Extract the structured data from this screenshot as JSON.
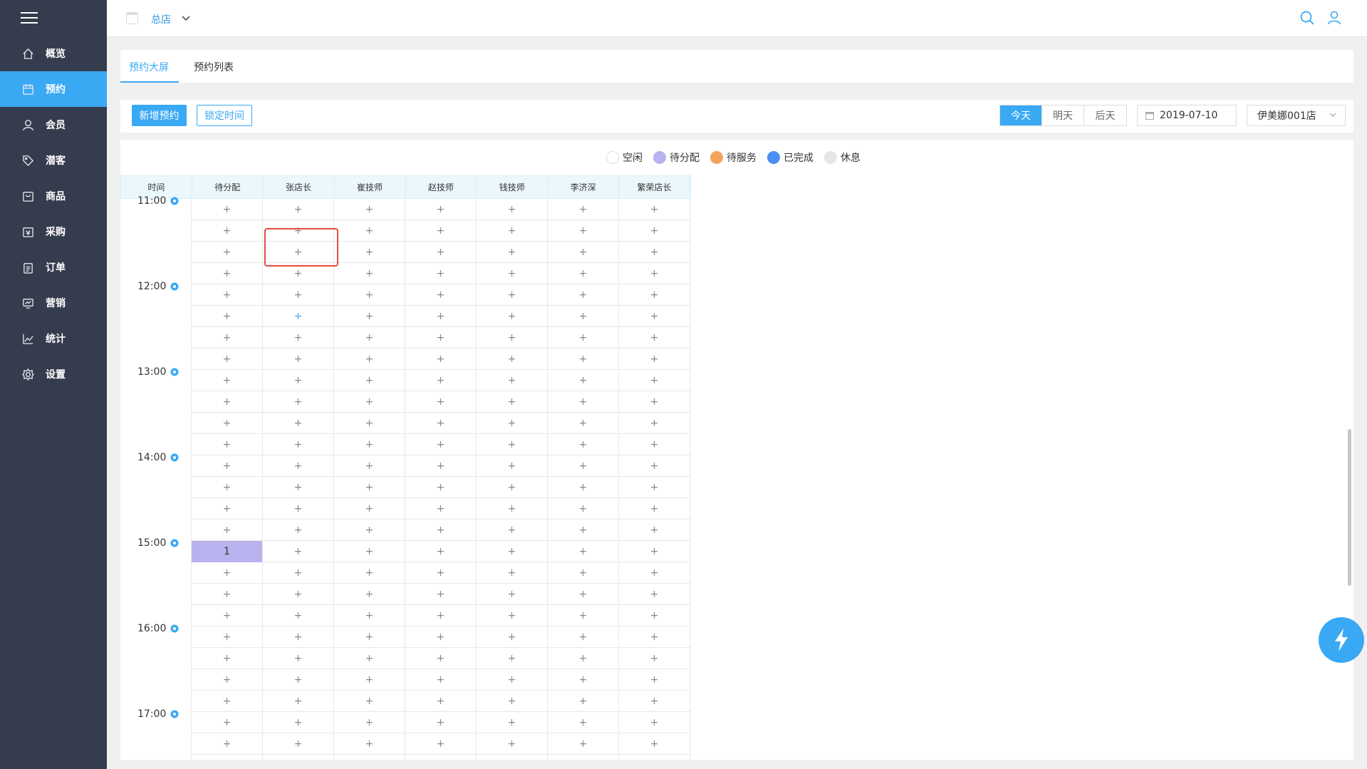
{
  "topbar": {
    "store": "总店"
  },
  "sidebar": {
    "items": [
      {
        "label": "概览",
        "icon": "home-icon"
      },
      {
        "label": "预约",
        "icon": "calendar-icon"
      },
      {
        "label": "会员",
        "icon": "user-icon"
      },
      {
        "label": "潜客",
        "icon": "tag-icon"
      },
      {
        "label": "商品",
        "icon": "box-icon"
      },
      {
        "label": "采购",
        "icon": "purchase-icon"
      },
      {
        "label": "订单",
        "icon": "clipboard-icon"
      },
      {
        "label": "营销",
        "icon": "marketing-icon"
      },
      {
        "label": "统计",
        "icon": "chart-icon"
      },
      {
        "label": "设置",
        "icon": "gear-icon"
      }
    ],
    "active": 1
  },
  "tabs": [
    {
      "label": "预约大屏",
      "active": true
    },
    {
      "label": "预约列表",
      "active": false
    }
  ],
  "toolbar": {
    "add_label": "新增预约",
    "lock_label": "锁定时间",
    "days": [
      "今天",
      "明天",
      "后天"
    ],
    "active_day": 0,
    "date": "2019-07-10",
    "shop": "伊美娜001店"
  },
  "legend": [
    {
      "label": "空闲",
      "color": "#ffffff"
    },
    {
      "label": "待分配",
      "color": "#b8b3ef"
    },
    {
      "label": "待服务",
      "color": "#f4a35b"
    },
    {
      "label": "已完成",
      "color": "#4a8ff2"
    },
    {
      "label": "休息",
      "color": "#e6e6e6"
    }
  ],
  "schedule": {
    "time_header": "时间",
    "columns": [
      "待分配",
      "张店长",
      "崔技师",
      "赵技师",
      "钱技师",
      "李济深",
      "繁荣店长"
    ],
    "times": [
      "11:00",
      "12:00",
      "13:00",
      "14:00",
      "15:00",
      "16:00",
      "17:00"
    ],
    "cell_symbol": "+",
    "booked_value": "1",
    "booked_row": 16,
    "booked_col": 0,
    "blue_plus_row": 5,
    "blue_plus_col": 1
  },
  "colors": {
    "accent": "#3aa9f4",
    "sidebar": "#353c4d",
    "highlight": "#e54b3c"
  }
}
